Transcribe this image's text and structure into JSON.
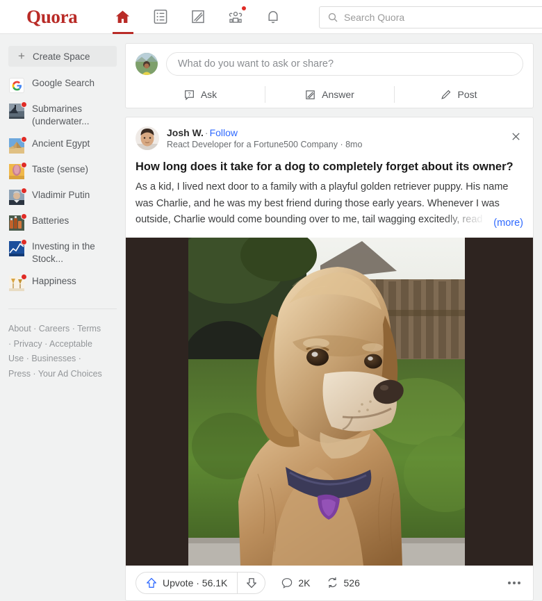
{
  "header": {
    "logo": "Quora",
    "nav": [
      {
        "name": "home-icon",
        "label": "Home",
        "active": true,
        "badge": false
      },
      {
        "name": "following-icon",
        "label": "Following",
        "active": false,
        "badge": false
      },
      {
        "name": "answer-icon",
        "label": "Answer",
        "active": false,
        "badge": false
      },
      {
        "name": "spaces-icon",
        "label": "Spaces",
        "active": false,
        "badge": true
      },
      {
        "name": "notifications-icon",
        "label": "Notifications",
        "active": false,
        "badge": false
      }
    ],
    "search": {
      "placeholder": "Search Quora",
      "value": "",
      "icon": "search-icon"
    }
  },
  "sidebar": {
    "create_space": {
      "label": "Create Space",
      "icon": "plus-icon"
    },
    "spaces": [
      {
        "label": "Google Search",
        "badge": false,
        "icon": "google-logo"
      },
      {
        "label": "Submarines (underwater...",
        "badge": true,
        "icon": "submarine-thumbnail"
      },
      {
        "label": "Ancient Egypt",
        "badge": true,
        "icon": "pyramid-thumbnail"
      },
      {
        "label": "Taste (sense)",
        "badge": true,
        "icon": "tongue-thumbnail"
      },
      {
        "label": "Vladimir Putin",
        "badge": true,
        "icon": "portrait-thumbnail"
      },
      {
        "label": "Batteries",
        "badge": true,
        "icon": "batteries-thumbnail"
      },
      {
        "label": "Investing in the Stock...",
        "badge": true,
        "icon": "stock-chart-thumbnail"
      },
      {
        "label": "Happiness",
        "badge": true,
        "icon": "celebration-thumbnail"
      }
    ],
    "footer_links": [
      "About",
      "Careers",
      "Terms",
      "Privacy",
      "Acceptable Use",
      "Businesses",
      "Press",
      "Your Ad Choices"
    ]
  },
  "composer": {
    "placeholder": "What do you want to ask or share?",
    "value": "",
    "actions": [
      {
        "label": "Ask",
        "icon": "question-box-icon"
      },
      {
        "label": "Answer",
        "icon": "pencil-lines-icon"
      },
      {
        "label": "Post",
        "icon": "pencil-icon"
      }
    ]
  },
  "post": {
    "author": "Josh W.",
    "separator": "·",
    "follow_label": "Follow",
    "credential": "React Developer for a Fortune500 Company · 8mo",
    "close_icon": "close-icon",
    "title": "How long does it take for a dog to completely forget about its owner?",
    "body": "As a kid, I lived next door to a family with a playful golden retriever puppy. His name was Charlie, and he was my best friend during those early years. Whenever I was outside, Charlie would come bounding over to me, tail wagging excitedly, read",
    "more_label": "(more)",
    "image_alt": "golden retriever dog sitting outdoors in front of a wooden fence",
    "actions": {
      "upvote_label": "Upvote · 56.1K",
      "upvote_icon": "upvote-arrow-icon",
      "downvote_icon": "downvote-arrow-icon",
      "comments_count": "2K",
      "comments_icon": "comment-bubble-icon",
      "shares_count": "526",
      "shares_icon": "repost-icon",
      "more_icon": "ellipsis-icon"
    }
  },
  "colors": {
    "brand_red": "#b92b27",
    "link_blue": "#2e69ff",
    "badge_red": "#e02c26",
    "page_bg": "#f1f2f2",
    "image_letterbox": "#2e2420"
  }
}
